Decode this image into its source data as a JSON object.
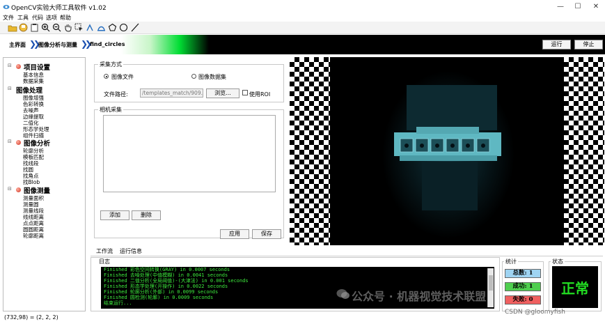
{
  "window": {
    "title": "OpenCV实验大师工具软件 v1.02",
    "minimize": "—",
    "maximize": "☐",
    "close": "✕"
  },
  "menu": [
    "文件",
    "工具",
    "代码",
    "选项",
    "帮助"
  ],
  "toolbar": [
    "folder-open-icon",
    "save-icon",
    "clipboard-icon",
    "zoom-in-icon",
    "zoom-out-icon",
    "hand-icon",
    "select-cursor-icon",
    "landmark-icon",
    "roi-icon",
    "polygon-icon",
    "circle-icon",
    "line-icon"
  ],
  "breadcrumb": {
    "home": "主界面",
    "section": "图像分析与测量",
    "current": "find_circles"
  },
  "actions": {
    "run": "运行",
    "stop": "停止"
  },
  "tree": [
    {
      "label": "项目设置",
      "children": [
        "基本信息",
        "数据采集"
      ]
    },
    {
      "label": "图像处理",
      "children": [
        "图像增强",
        "色彩转换",
        "去噪声",
        "边缘提取",
        "二值化",
        "形态学处理",
        "组件扫描"
      ]
    },
    {
      "label": "图像分析",
      "children": [
        "轮廓分析",
        "模板匹配",
        "找线段",
        "找圆",
        "找角点",
        "找Blob"
      ]
    },
    {
      "label": "图像测量",
      "children": [
        "测量面积",
        "测量圆",
        "测量线段",
        "线线距离",
        "点点距离",
        "圆圆距离",
        "轮廓距离"
      ]
    }
  ],
  "acquisition": {
    "title": "采集方式",
    "option_file": "图像文件",
    "option_dataset": "图像数据集",
    "path_label": "文件路径:",
    "path_value": "/templates_match/909.jpg",
    "browse": "浏览...",
    "use_roi": "使用ROI"
  },
  "camera": {
    "title": "相机采集",
    "add": "添加",
    "delete": "删除"
  },
  "apply": "应用",
  "save": "保存",
  "tabs": [
    "工作流",
    "运行信息"
  ],
  "log": {
    "title": "日志",
    "lines": [
      "Finished 彩色空间转换(GRAY) in 0.0007 seconds",
      "Finished 去噪处理(中值模糊) in 0.0041 seconds",
      "Finished 二值分析(全局阈值)-(大津法) in 0.001 seconds",
      "Finished 形态学处理(开操作) in 0.0022 seconds",
      "Finished 轮廓分析(外部) in 0.0099 seconds",
      "Finished 圆检测(轮廓) in 0.0009 seconds",
      "结束运行..."
    ]
  },
  "stats": {
    "title": "统计",
    "total": "总数: 1",
    "success": "成功: 1",
    "fail": "失败: 0"
  },
  "status": {
    "title": "状态",
    "value": "正常"
  },
  "coord": "(732,98) = (2, 2, 2)",
  "watermark": "公众号 · 机器视觉技术联盟",
  "credit": "CSDN @gloomyfish",
  "colors": {
    "accent_blue": "#1a4fb0",
    "ok_green": "#22dd22",
    "log_green": "#3dea3d",
    "stat_total": "#9fd4f2",
    "stat_success": "#4fcf4f",
    "stat_fail": "#f06060"
  }
}
